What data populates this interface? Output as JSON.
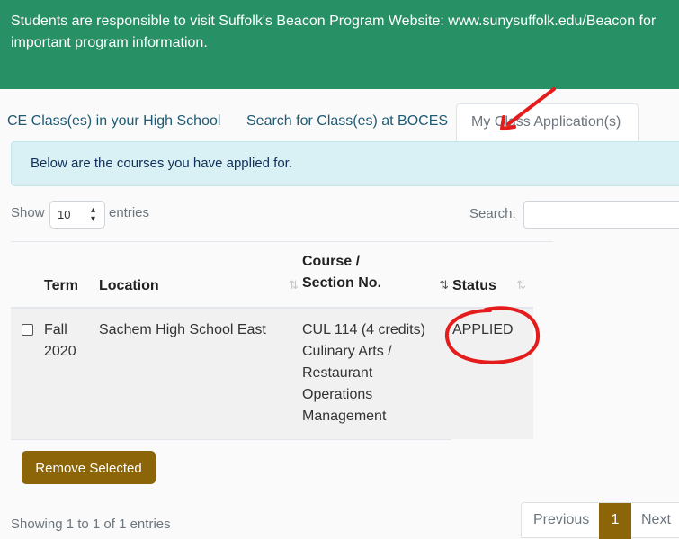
{
  "banner": {
    "text": "Students are responsible to visit Suffolk's Beacon Program Website: www.sunysuffolk.edu/Beacon for important program information."
  },
  "tabs": [
    {
      "label": "CE Class(es) in your High School",
      "active": false
    },
    {
      "label": "Search for Class(es) at BOCES",
      "active": false
    },
    {
      "label": "My Class Application(s)",
      "active": true
    }
  ],
  "info_message": "Below are the courses you have applied for.",
  "table_controls": {
    "show_label": "Show",
    "entries_label": "entries",
    "page_length": "10",
    "search_label": "Search:",
    "search_value": ""
  },
  "table": {
    "columns": [
      {
        "label": "",
        "sortable": false
      },
      {
        "label": "Term",
        "sortable": false
      },
      {
        "label": "Location",
        "sortable": true
      },
      {
        "label": "Course / Section No.",
        "sortable": true
      },
      {
        "label": "Status",
        "sortable": true
      }
    ],
    "sort_icon": "⇅",
    "rows": [
      {
        "checked": false,
        "term": "Fall 2020",
        "location": "Sachem High School East",
        "course": "CUL 114 (4 credits) Culinary Arts / Restaurant Operations Management",
        "status": "APPLIED"
      }
    ]
  },
  "actions": {
    "remove_selected": "Remove Selected"
  },
  "footer": {
    "info": "Showing 1 to 1 of 1 entries",
    "pagination": {
      "previous": "Previous",
      "current_page": "1",
      "next": "Next"
    }
  },
  "colors": {
    "banner": "#289065",
    "accent_gold": "#8b6508",
    "info_bg": "#d9f0f4",
    "annotation_red": "#e41c1c"
  }
}
